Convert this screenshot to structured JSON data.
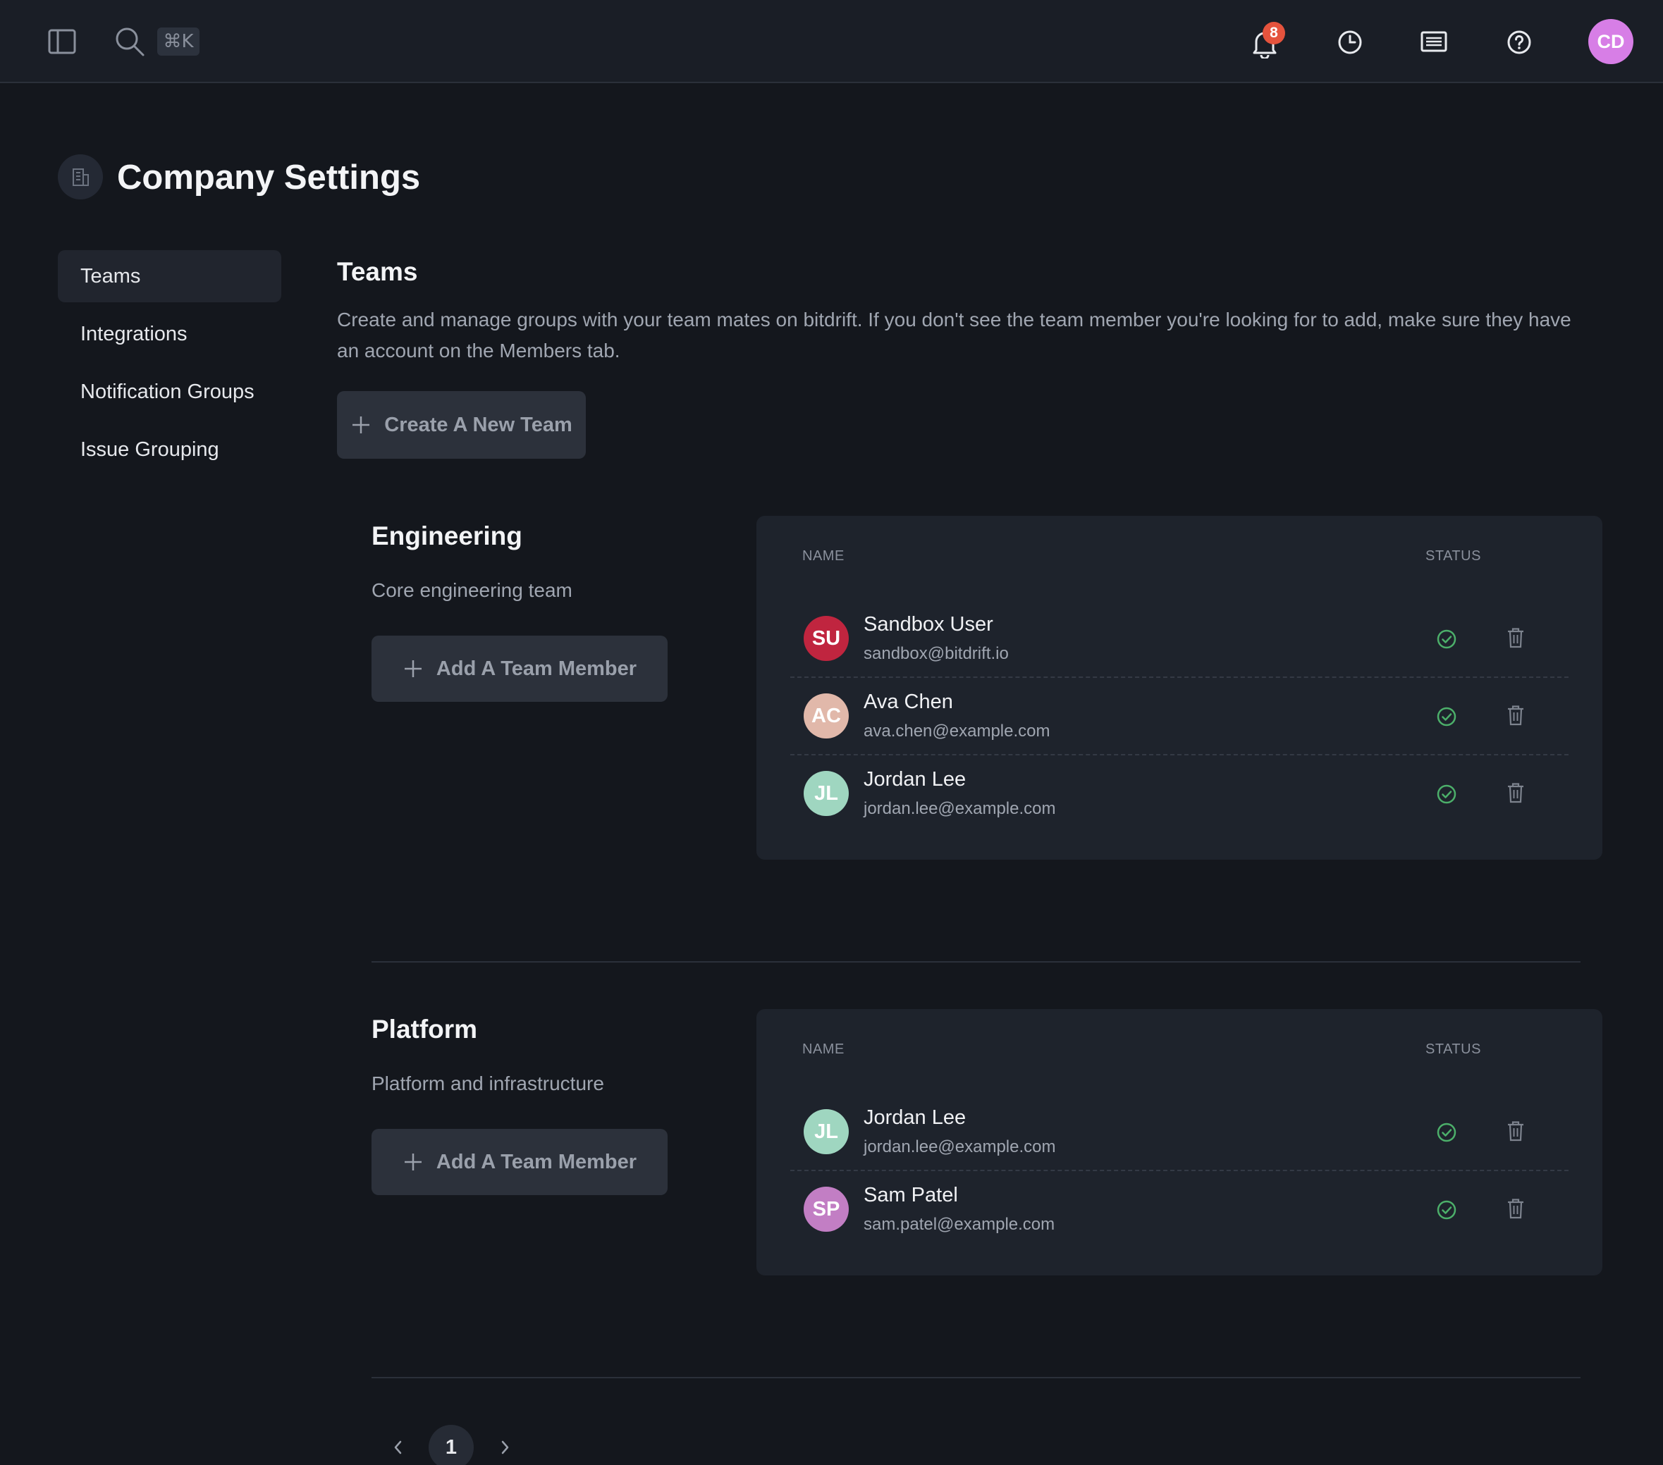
{
  "topbar": {
    "shortcut": "⌘K",
    "notification_count": "8",
    "user_initials": "CD"
  },
  "page": {
    "title": "Company Settings"
  },
  "sidebar": {
    "items": [
      {
        "label": "Teams",
        "active": true
      },
      {
        "label": "Integrations"
      },
      {
        "label": "Notification Groups"
      },
      {
        "label": "Issue Grouping"
      }
    ]
  },
  "main": {
    "title": "Teams",
    "description": "Create and manage groups with your team mates on bitdrift. If you don't see the team member you're looking for to add, make sure they have an account on the Members tab.",
    "create_button": "Create A New Team"
  },
  "table_headers": {
    "name": "NAME",
    "status": "STATUS"
  },
  "teams": [
    {
      "name": "Engineering",
      "description": "Core engineering team",
      "add_button": "Add A Team Member",
      "members": [
        {
          "initials": "SU",
          "name": "Sandbox User",
          "email": "sandbox@bitdrift.io",
          "color": "#c0253f"
        },
        {
          "initials": "AC",
          "name": "Ava Chen",
          "email": "ava.chen@example.com",
          "color": "#e1b8aa"
        },
        {
          "initials": "JL",
          "name": "Jordan Lee",
          "email": "jordan.lee@example.com",
          "color": "#9fd6c0"
        }
      ]
    },
    {
      "name": "Platform",
      "description": "Platform and infrastructure",
      "add_button": "Add A Team Member",
      "members": [
        {
          "initials": "JL",
          "name": "Jordan Lee",
          "email": "jordan.lee@example.com",
          "color": "#9fd6c0"
        },
        {
          "initials": "SP",
          "name": "Sam Patel",
          "email": "sam.patel@example.com",
          "color": "#c27ec4"
        }
      ]
    }
  ],
  "pagination": {
    "current": "1"
  },
  "colors": {
    "status_ok": "#4caf6a",
    "accent_badge": "#e5533d"
  }
}
